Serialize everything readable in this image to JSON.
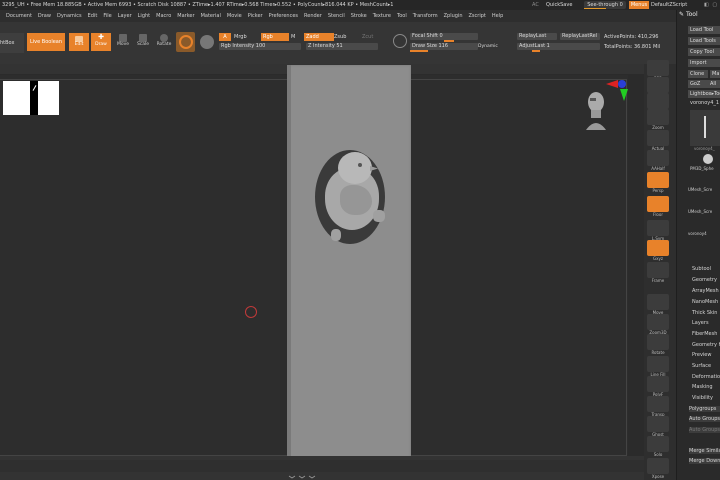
{
  "infobar": {
    "text": "3295_UH   • Free Mem 18.885GB • Active Mem 6993 • Scratch Disk 10887 • ZTime▸1.407 RTime▸0.568 Timer▸0.552 • PolyCount▸816.044 KP • MeshCount▸1",
    "ac": "AC",
    "quicksave": "QuickSave",
    "see_through": "See-through  0",
    "menus": "Menus",
    "default_zscript": "DefaultZScript",
    "window_icons": "◧ ▢ ✕"
  },
  "menubar": [
    "Document",
    "Draw",
    "Dynamics",
    "Edit",
    "File",
    "Layer",
    "Light",
    "Macro",
    "Marker",
    "Material",
    "Movie",
    "Picker",
    "Preferences",
    "Render",
    "Stencil",
    "Stroke",
    "Texture",
    "Tool",
    "Transform",
    "Zplugin",
    "Zscript",
    "Help"
  ],
  "shelf": {
    "lightbox": "htBox",
    "live_boolean": "Live Boolean",
    "edit": "Edit",
    "draw": "Draw",
    "move": "Move",
    "scale": "Scale",
    "rotate": "Rotate",
    "a": "A",
    "mrgb": "Mrgb",
    "rgb": "Rgb",
    "m": "M",
    "rgb_intensity": "Rgb Intensity 100",
    "zadd": "Zadd",
    "zsub": "Zsub",
    "zcut": "Zcut",
    "z_intensity": "Z Intensity 51",
    "focal_shift": "Focal Shift  0",
    "draw_size": "Draw Size  116",
    "dynamic": "Dynamic",
    "replay_last": "ReplayLast",
    "replay_last_rel": "ReplayLastRel",
    "adjust_last": "AdjustLast  1",
    "active_points": "ActivePoints: 410,296",
    "total_points": "TotalPoints: 36.801 Mil"
  },
  "right_toolbar": [
    "BPR",
    "SPix 3",
    "Scroll",
    "Zoom",
    "Actual",
    "AAHalf",
    "Persp",
    "Floor",
    "L.Sym",
    "Gxyz",
    "Frame",
    "Move",
    "Zoom3D",
    "Rotate",
    "Line Fill",
    "PolyF",
    "Transp",
    "Ghost",
    "Solo",
    "Xpose"
  ],
  "tool_panel": {
    "title": "Tool",
    "load_tool": "Load Tool",
    "save_as": "Load Tools",
    "copy_tool": "Copy Tool",
    "import": "Import",
    "clone": "Clone",
    "goz": "GoZ",
    "all": "All",
    "lightbox_tools": "Lightbox▸Tools",
    "current_tool": "voronoy4_1",
    "thumb_labels": [
      "voronoy4_",
      "PM3D_Sphe",
      "UMesh_Scre",
      "UMesh_Scre",
      "voronoy4"
    ],
    "subpalettes": [
      "Subtool",
      "Geometry",
      "ArrayMesh",
      "NanoMesh",
      "Thick Skin",
      "Layers",
      "FiberMesh",
      "Geometry HD",
      "Preview",
      "Surface",
      "Deformation",
      "Masking",
      "Visibility",
      "Polygroups",
      "Auto Groups",
      "Auto Groups With UV",
      "Merge Similar",
      "Merge Down"
    ]
  },
  "colors": {
    "accent": "#e8822a",
    "canvas": "#2d2d2d",
    "plane": "#8d8d8d"
  }
}
